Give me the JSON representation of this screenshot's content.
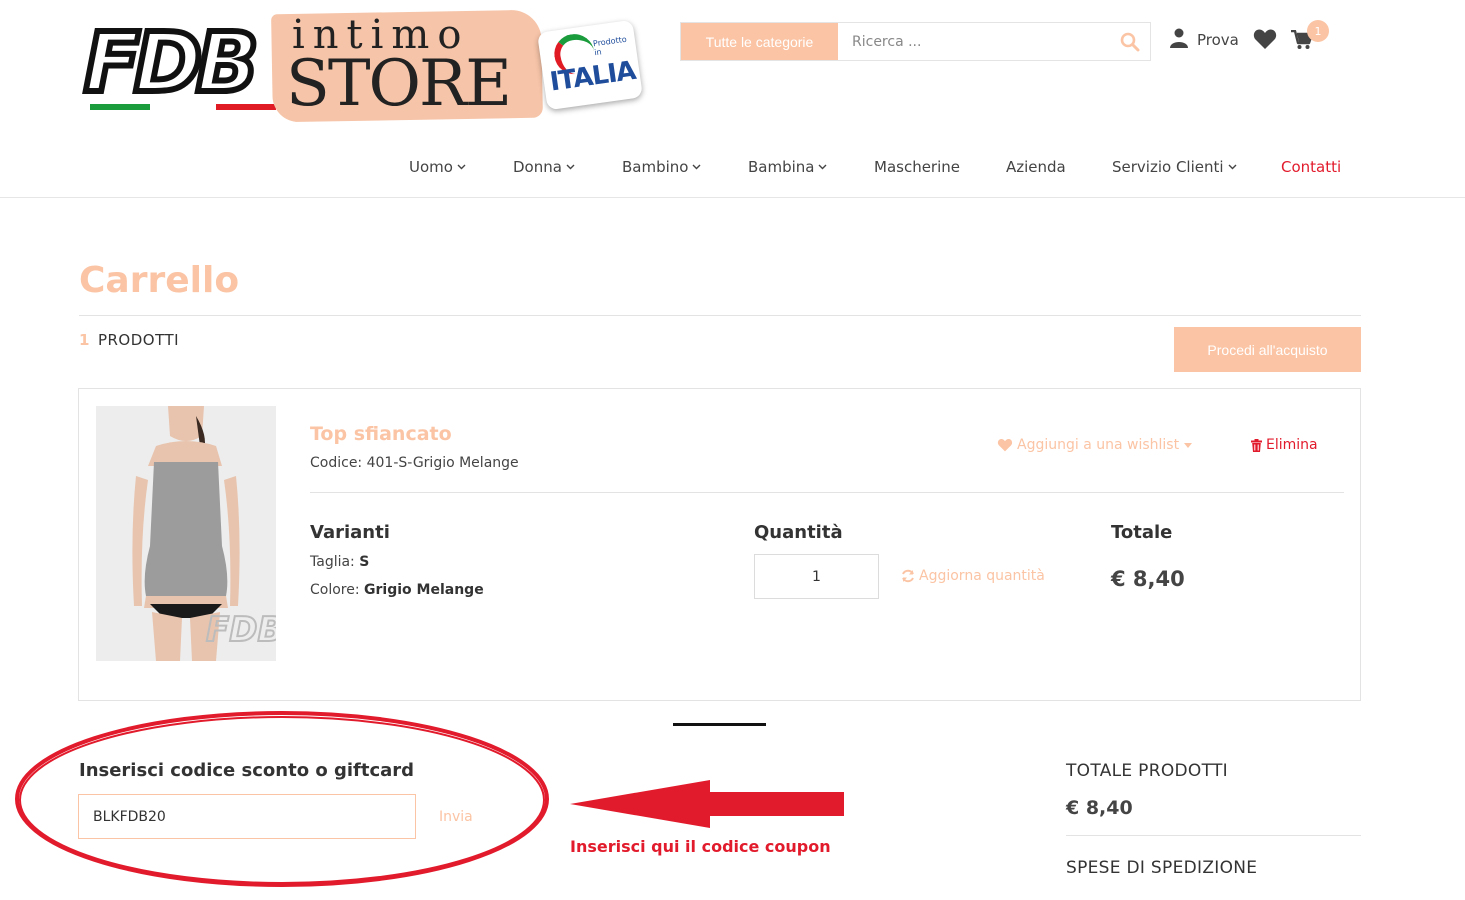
{
  "logo": {
    "brand_letters": "FDB",
    "word_intimo": "intimo",
    "word_store": "STORE",
    "badge_text": "ITALIA",
    "badge_small": "Prodotto in"
  },
  "header": {
    "categories_button": "Tutte le categorie",
    "search_placeholder": "Ricerca ...",
    "user_name": "Prova",
    "cart_count": "1"
  },
  "nav": {
    "items": [
      {
        "label": "Uomo",
        "has_dropdown": true
      },
      {
        "label": "Donna",
        "has_dropdown": true
      },
      {
        "label": "Bambino",
        "has_dropdown": true
      },
      {
        "label": "Bambina",
        "has_dropdown": true
      },
      {
        "label": "Mascherine",
        "has_dropdown": false
      },
      {
        "label": "Azienda",
        "has_dropdown": false
      },
      {
        "label": "Servizio Clienti",
        "has_dropdown": true
      },
      {
        "label": "Contatti",
        "has_dropdown": false
      }
    ]
  },
  "cart": {
    "title": "Carrello",
    "count": "1",
    "count_label": "PRODOTTI",
    "checkout_label": "Procedi all'acquisto"
  },
  "product": {
    "name": "Top sfiancato",
    "code": "Codice: 401-S-Grigio Melange",
    "wishlist_label": "Aggiungi a una wishlist",
    "delete_label": "Elimina",
    "variants_heading": "Varianti",
    "size_label": "Taglia:",
    "size_value": "S",
    "color_label": "Colore:",
    "color_value": "Grigio Melange",
    "quantity_heading": "Quantità",
    "quantity_value": "1",
    "update_label": "Aggiorna quantità",
    "total_heading": "Totale",
    "total_value": "€ 8,40",
    "watermark": "FDB"
  },
  "coupon": {
    "title": "Inserisci codice sconto o giftcard",
    "value": "BLKFDB20",
    "send_label": "Invia",
    "annotation_text": "Inserisci qui il codice coupon"
  },
  "summary": {
    "products_label": "TOTALE PRODOTTI",
    "products_value": "€ 8,40",
    "shipping_label": "SPESE DI SPEDIZIONE"
  },
  "colors": {
    "accent": "#fbc4a4",
    "red": "#e21b2c",
    "text": "#333333"
  }
}
